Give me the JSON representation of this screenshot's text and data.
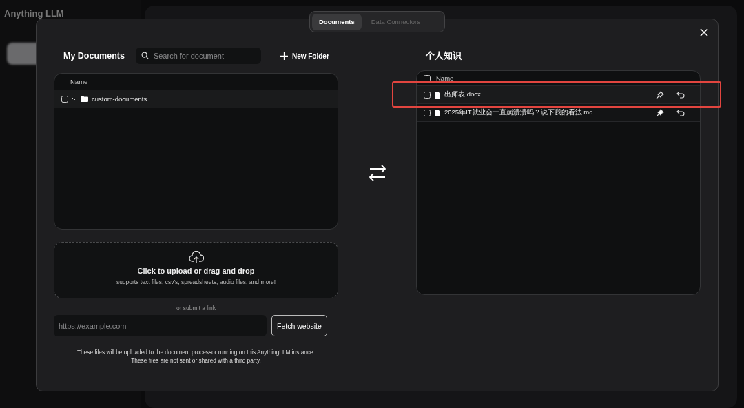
{
  "app_title": "Anything LLM",
  "tabs": [
    {
      "label": "Documents",
      "selected": true
    },
    {
      "label": "Data Connectors",
      "selected": false
    }
  ],
  "my_documents": {
    "title": "My Documents",
    "search": {
      "placeholder": "Search for document"
    },
    "new_folder": "New Folder",
    "table": {
      "columns": [
        "Name"
      ],
      "rows": [
        {
          "kind": "folder",
          "name": "custom-documents",
          "checked": false
        }
      ]
    }
  },
  "upload": {
    "title": "Click to upload or drag and drop",
    "subtitle": "supports text files, csv's, spreadsheets, audio files, and more!",
    "link_label": "or submit a link",
    "url_field": {
      "placeholder": "https://example.com"
    },
    "fetch_button": "Fetch website",
    "notice": [
      "These files will be uploaded to the document processor running on this AnythingLLM instance.",
      "These files are not sent or shared with a third party."
    ]
  },
  "workspace": {
    "title": "个人知识",
    "table": {
      "all_checked": false,
      "columns": [
        "Name"
      ],
      "rows": [
        {
          "kind": "file",
          "name": "出师表.docx",
          "checked": false,
          "pinned": false,
          "highlighted": true
        },
        {
          "kind": "file",
          "name": "2025年IT就业会一直崩溃溃吗？说下我的看法.md",
          "checked": false,
          "pinned": true,
          "highlighted": false
        }
      ]
    }
  }
}
